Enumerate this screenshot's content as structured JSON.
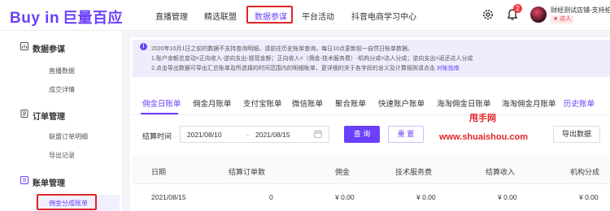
{
  "header": {
    "logo_en": "Buy in",
    "logo_cn": "巨量百应",
    "nav": [
      {
        "label": "直播管理"
      },
      {
        "label": "精选联盟"
      },
      {
        "label": "数据参谋"
      },
      {
        "label": "平台活动"
      },
      {
        "label": "抖音电商学习中心"
      }
    ],
    "notification_count": "2",
    "user_name": "财经测试店铺-支持拍",
    "user_tag": "达人"
  },
  "sidebar": {
    "sections": [
      {
        "title": "数据参谋",
        "items": [
          "直播数据",
          "成交详情"
        ]
      },
      {
        "title": "订单管理",
        "items": [
          "联盟订单明细",
          "导出记录"
        ]
      },
      {
        "title": "账单管理",
        "items": [
          "佣金分成账单"
        ]
      }
    ]
  },
  "notice": {
    "line1": "2020年10月1日之前的数据不支持查询明细，请前往历史账单查询，每日10点更新前一自然日账单数据。",
    "line2": "1.账户余额总变动=正向收入-逆向支出-提现金额；正向收入=（佣金-技术服务费）-机构分成=达人分成；逆向支出=返还达人分成",
    "line3": "2.点击导出数据可导出汇总账单及所选择的时间范围内的明细账单，更详细的关于各字段的含义及计算规则请点击",
    "link": "对账指南"
  },
  "tabs": [
    "佣金日账单",
    "佣金月账单",
    "支付宝账单",
    "微信账单",
    "聚合账单",
    "快速账户账单",
    "海淘佣金日账单",
    "海淘佣金月账单",
    "历史账单"
  ],
  "filter": {
    "label": "结算时间",
    "start_date": "2021/08/10",
    "separator": "-",
    "end_date": "2021/08/15",
    "query_label": "查 询",
    "reset_label": "重 置",
    "export_label": "导出数据"
  },
  "watermark": {
    "line1": "甩手网",
    "line2": "www.shuaishou.com"
  },
  "table": {
    "columns": [
      "日期",
      "结算订单数",
      "佣金",
      "技术服务费",
      "结算收入",
      "机构分成"
    ],
    "rows": [
      [
        "2021/08/15",
        "0",
        "¥ 0.00",
        "¥ 0.00",
        "¥ 0.00",
        "¥ 0.00"
      ]
    ]
  },
  "colors": {
    "brand": "#6b3ffb",
    "highlight": "#e0252a"
  }
}
